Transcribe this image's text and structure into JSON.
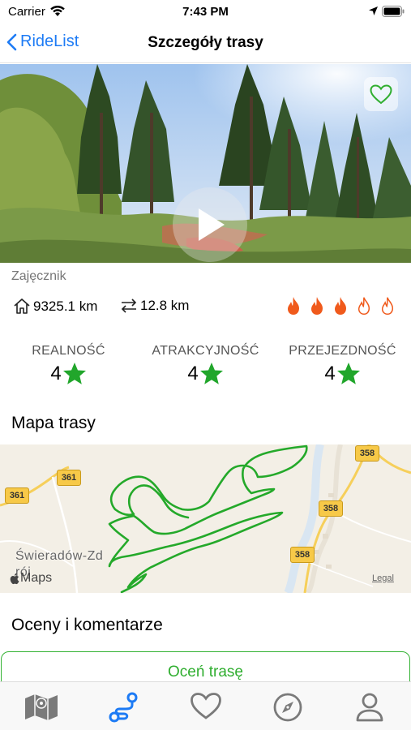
{
  "status_bar": {
    "carrier": "Carrier",
    "time": "7:43 PM"
  },
  "nav": {
    "back_label": "RideList",
    "title": "Szczegóły trasy"
  },
  "route": {
    "name": "Zajęcznik",
    "distance_from_home": "9325.1 km",
    "route_length": "12.8 km",
    "difficulty_level": 3,
    "difficulty_max": 5
  },
  "ratings": [
    {
      "label": "REALNOŚĆ",
      "value": "4"
    },
    {
      "label": "ATRAKCYJNOŚĆ",
      "value": "4"
    },
    {
      "label": "PRZEJEZDNOŚĆ",
      "value": "4"
    }
  ],
  "map_section": {
    "title": "Mapa trasy",
    "town": "Świeradów-Zdrój",
    "roads": [
      "361",
      "361",
      "358",
      "358",
      "358"
    ],
    "maps_logo": "Maps",
    "legal": "Legal"
  },
  "comments_section": {
    "title": "Oceny i komentarze",
    "rate_button": "Oceń trasę"
  },
  "tabs": [
    {
      "icon": "map-icon",
      "active": false
    },
    {
      "icon": "route-icon",
      "active": true
    },
    {
      "icon": "heart-icon",
      "active": false
    },
    {
      "icon": "compass-icon",
      "active": false
    },
    {
      "icon": "profile-icon",
      "active": false
    }
  ],
  "colors": {
    "accent": "#1d7bf5",
    "green": "#2fae2f",
    "flame": "#f05a1c",
    "tab_inactive": "#7a7a7a"
  }
}
